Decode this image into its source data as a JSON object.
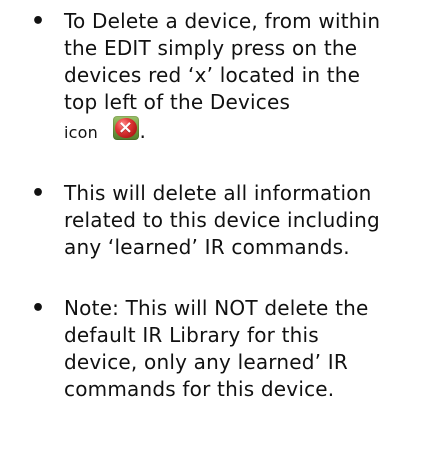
{
  "bullets": [
    {
      "text_before_icon": "To Delete a device, from within the EDIT simply press on the devices red ‘x’ located in the top left of the Devices",
      "icon_label": "icon",
      "icon_name": "red-x-delete-icon",
      "icon_glyph": "×",
      "text_after_icon": "."
    },
    {
      "text": "This will delete all information related to this device including any ‘learned’ IR commands."
    },
    {
      "text": "Note: This will NOT delete the default IR Library for this device, only any learned’ IR commands for this device."
    }
  ],
  "bullet_symbol": "•"
}
